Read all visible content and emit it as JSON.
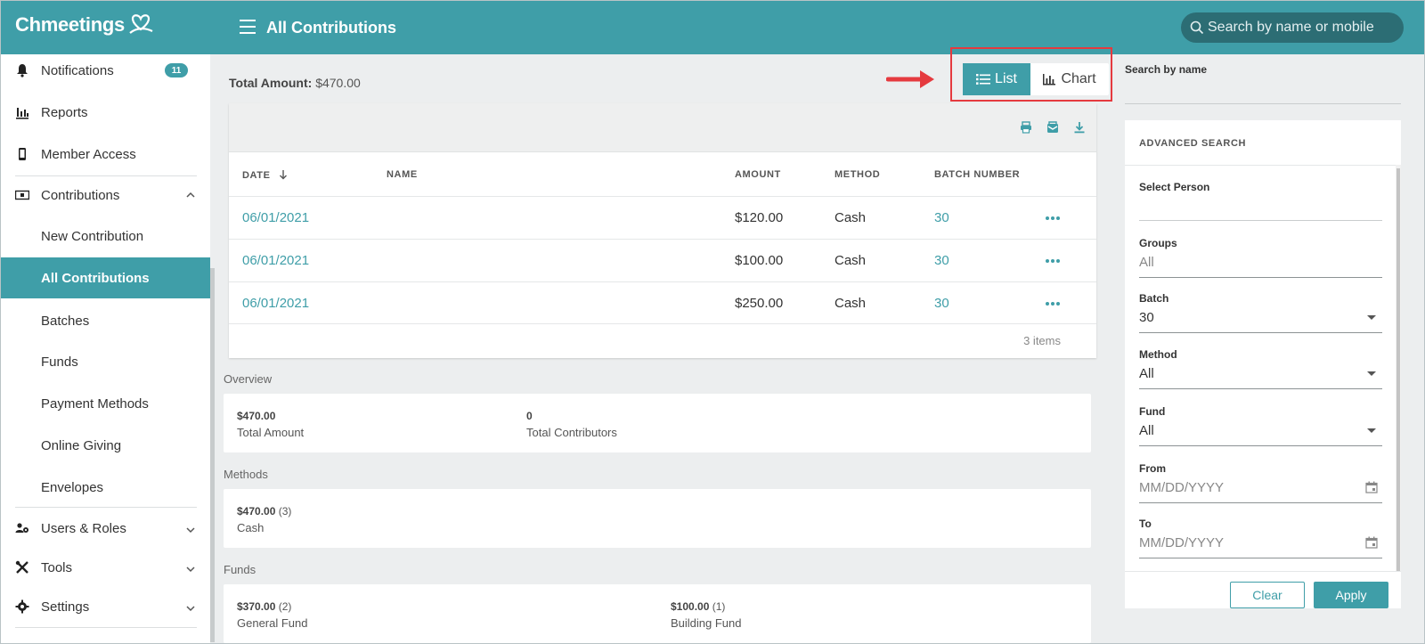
{
  "brand": {
    "name": "Chmeetings",
    "accent": "#3f9ea8"
  },
  "header": {
    "title": "All Contributions",
    "search_placeholder": "Search by name or mobile"
  },
  "sidebar": {
    "notifications": {
      "label": "Notifications",
      "count": "11"
    },
    "reports": "Reports",
    "member_access": "Member Access",
    "contributions": "Contributions",
    "sub": [
      "New Contribution",
      "All Contributions",
      "Batches",
      "Funds",
      "Payment Methods",
      "Online Giving",
      "Envelopes"
    ],
    "users_roles": "Users & Roles",
    "tools": "Tools",
    "settings": "Settings"
  },
  "main": {
    "total_label": "Total Amount:",
    "total_value": "$470.00",
    "view_toggle": {
      "list": "List",
      "chart": "Chart",
      "selected": "List"
    },
    "columns": [
      "DATE",
      "NAME",
      "AMOUNT",
      "METHOD",
      "BATCH NUMBER"
    ],
    "rows": [
      {
        "date": "06/01/2021",
        "name": "",
        "amount": "$120.00",
        "method": "Cash",
        "batch": "30"
      },
      {
        "date": "06/01/2021",
        "name": "",
        "amount": "$100.00",
        "method": "Cash",
        "batch": "30"
      },
      {
        "date": "06/01/2021",
        "name": "",
        "amount": "$250.00",
        "method": "Cash",
        "batch": "30"
      }
    ],
    "items_count": "3 items",
    "overview": {
      "title": "Overview",
      "total_amount": {
        "value": "$470.00",
        "label": "Total Amount"
      },
      "total_contributors": {
        "value": "0",
        "label": "Total Contributors"
      }
    },
    "methods": {
      "title": "Methods",
      "items": [
        {
          "value": "$470.00",
          "count": "(3)",
          "label": "Cash"
        }
      ]
    },
    "funds": {
      "title": "Funds",
      "items": [
        {
          "value": "$370.00",
          "count": "(2)",
          "label": "General Fund"
        },
        {
          "value": "$100.00",
          "count": "(1)",
          "label": "Building Fund"
        }
      ]
    }
  },
  "right_panel": {
    "search_by_name": "Search by name",
    "advanced_title": "ADVANCED SEARCH",
    "select_person": "Select Person",
    "groups": {
      "label": "Groups",
      "value": "All"
    },
    "batch": {
      "label": "Batch",
      "value": "30"
    },
    "method": {
      "label": "Method",
      "value": "All"
    },
    "fund": {
      "label": "Fund",
      "value": "All"
    },
    "from": {
      "label": "From",
      "placeholder": "MM/DD/YYYY"
    },
    "to": {
      "label": "To",
      "placeholder": "MM/DD/YYYY"
    },
    "clear": "Clear",
    "apply": "Apply"
  }
}
